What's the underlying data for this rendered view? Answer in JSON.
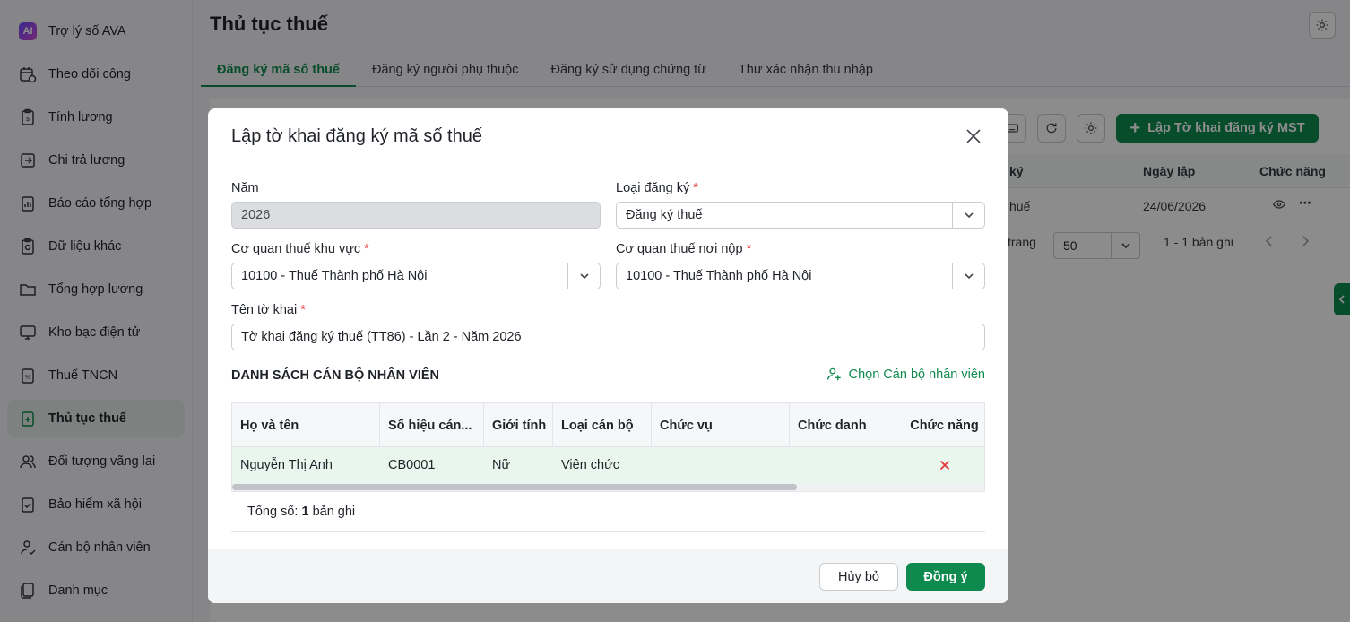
{
  "sidebar": {
    "items": [
      {
        "label": "Trợ lý số AVA",
        "icon": "ai-assistant-icon"
      },
      {
        "label": "Theo dõi công",
        "icon": "calendar-clock-icon"
      },
      {
        "label": "Tính lương",
        "icon": "salary-doc-icon"
      },
      {
        "label": "Chi trả lương",
        "icon": "payment-icon"
      },
      {
        "label": "Báo cáo tổng hợp",
        "icon": "report-icon"
      },
      {
        "label": "Dữ liệu khác",
        "icon": "data-icon"
      },
      {
        "label": "Tổng hợp lương",
        "icon": "folder-icon"
      },
      {
        "label": "Kho bạc điện tử",
        "icon": "monitor-icon"
      },
      {
        "label": "Thuế TNCN",
        "icon": "tax-icon"
      },
      {
        "label": "Thủ tục thuế",
        "icon": "tax-procedure-icon"
      },
      {
        "label": "Đối tượng vãng lai",
        "icon": "users-icon"
      },
      {
        "label": "Bảo hiểm xã hội",
        "icon": "insurance-icon"
      },
      {
        "label": "Cán bộ nhân viên",
        "icon": "user-check-icon"
      },
      {
        "label": "Danh mục",
        "icon": "catalog-icon"
      }
    ],
    "active_index": 9
  },
  "header": {
    "title": "Thủ tục thuế"
  },
  "tabs": [
    {
      "label": "Đăng ký mã số thuế"
    },
    {
      "label": "Đăng ký người phụ thuộc"
    },
    {
      "label": "Đăng ký sử dụng chứng từ"
    },
    {
      "label": "Thư xác nhận thu nhập"
    }
  ],
  "background": {
    "create_button": "Lập Tờ khai đăng ký MST",
    "columns": [
      "ký",
      "Ngày lập",
      "Chức năng"
    ],
    "row": {
      "col1": "huế",
      "date": "24/06/2026"
    },
    "pager": {
      "label": "trang",
      "page_size": "50",
      "range": "1 - 1 bản ghi"
    }
  },
  "modal": {
    "title": "Lập tờ khai đăng ký mã số thuế",
    "fields": {
      "year": {
        "label": "Năm",
        "value": "2026"
      },
      "reg_type": {
        "label": "Loại đăng ký",
        "value": "Đăng ký thuế"
      },
      "tax_office_area": {
        "label": "Cơ quan thuế khu vực",
        "value": "10100 - Thuế Thành phố Hà Nội"
      },
      "tax_office_submit": {
        "label": "Cơ quan thuế nơi nộp",
        "value": "10100 - Thuế Thành phố Hà Nội"
      },
      "form_name": {
        "label": "Tên tờ khai",
        "value": "Tờ khai đăng ký thuế (TT86) - Lần 2 - Năm 2026"
      }
    },
    "required_mark": "*",
    "section_title": "DANH SÁCH CÁN BỘ NHÂN VIÊN",
    "choose_employee": "Chọn Cán bộ nhân viên",
    "table": {
      "columns": [
        "Họ và tên",
        "Số hiệu cán...",
        "Giới tính",
        "Loại cán bộ",
        "Chức vụ",
        "Chức danh",
        "Chức năng"
      ],
      "rows": [
        {
          "name": "Nguyễn Thị Anh",
          "code": "CB0001",
          "gender": "Nữ",
          "type": "Viên chức",
          "position": "",
          "title": ""
        }
      ]
    },
    "total_prefix": "Tổng số:",
    "total_count": "1",
    "total_suffix": "bản ghi",
    "buttons": {
      "cancel": "Hủy bỏ",
      "ok": "Đồng ý"
    }
  },
  "colors": {
    "primary": "#0e8a4f",
    "danger": "#e5383b"
  }
}
